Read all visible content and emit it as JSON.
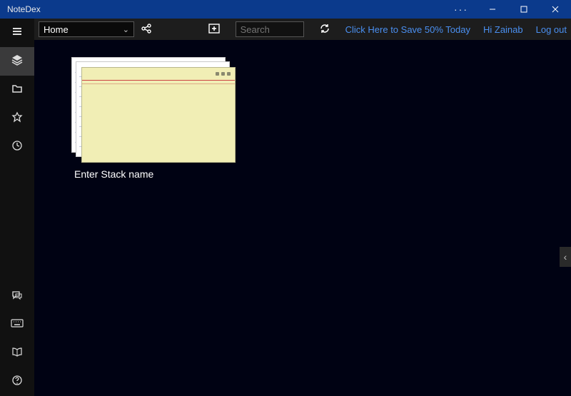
{
  "titlebar": {
    "app_name": "NoteDex"
  },
  "toolbar": {
    "home_label": "Home",
    "search_placeholder": "Search",
    "promo_label": "Click Here to Save 50% Today",
    "greeting_label": "Hi Zainab",
    "logout_label": "Log out"
  },
  "stack": {
    "name_label": "Enter Stack name"
  },
  "icons": {
    "menu": "menu-icon",
    "stacks": "stacks-icon",
    "folder": "folder-icon",
    "star": "star-icon",
    "clock": "clock-icon",
    "chat": "chat-icon",
    "keyboard": "keyboard-icon",
    "book": "book-icon",
    "help": "help-icon"
  }
}
